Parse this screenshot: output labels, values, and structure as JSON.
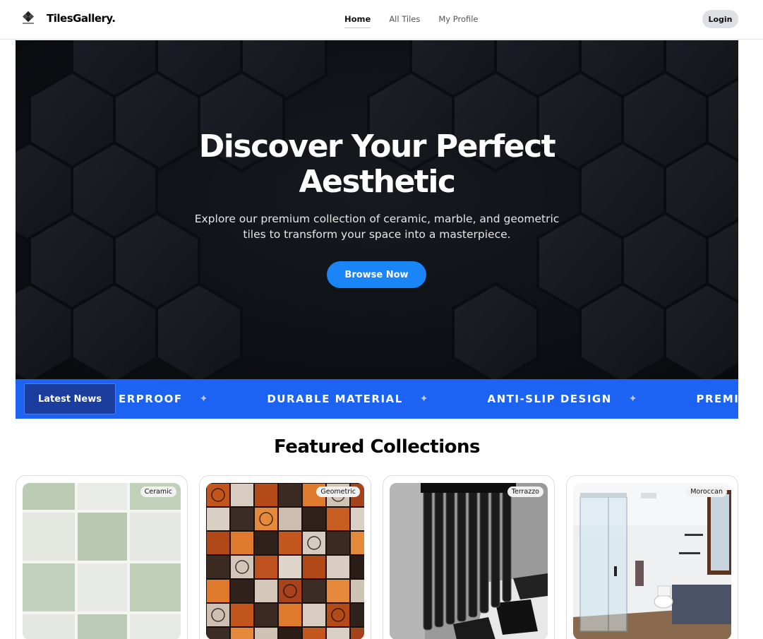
{
  "nav": {
    "brand": "TilesGallery.",
    "links": [
      "Home",
      "All Tiles",
      "My Profile"
    ],
    "login": "Login"
  },
  "hero": {
    "title_line1": "Discover Your Perfect",
    "title_line2": "Aesthetic",
    "subtitle_line1": "Explore our premium collection of ceramic, marble, and geometric",
    "subtitle_line2": "tiles to transform your space into a masterpiece.",
    "cta": "Browse Now"
  },
  "ticker": {
    "badge": "Latest News",
    "items": [
      "ERPROOF",
      "DURABLE MATERIAL",
      "ANTI-SLIP DESIGN",
      "PREMIUM"
    ]
  },
  "featured": {
    "title": "Featured Collections",
    "cards": [
      {
        "tag": "Ceramic"
      },
      {
        "tag": "Geometric"
      },
      {
        "tag": "Terrazzo"
      },
      {
        "tag": "Moroccan"
      }
    ]
  },
  "colors": {
    "accent": "#1a85f7",
    "ticker_bg": "#1c63f4",
    "badge_bg": "#1a3d9e",
    "hero_bg": "#0f1217"
  },
  "icons": {
    "logo": "tile-logo-icon",
    "ticker_separator": "sparkle-icon"
  }
}
